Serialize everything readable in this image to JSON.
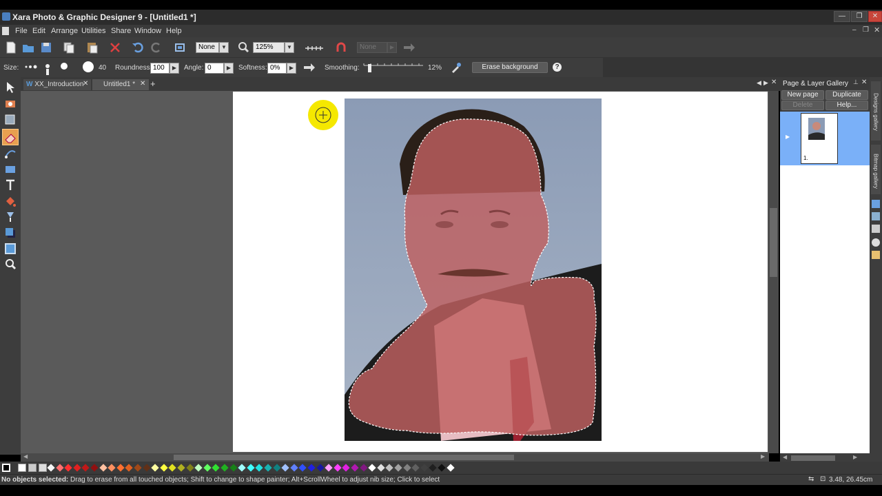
{
  "window": {
    "title": "Xara Photo & Graphic Designer 9 - [Untitled1 *]"
  },
  "menu": [
    "File",
    "Edit",
    "Arrange",
    "Utilities",
    "Share",
    "Window",
    "Help"
  ],
  "toolbar": {
    "quality_select": "None",
    "zoom_select": "125%",
    "disabled_select": "None"
  },
  "infobar": {
    "size_label": "Size:",
    "size_value": "40",
    "roundness_label": "Roundness:",
    "roundness_value": "100",
    "angle_label": "Angle:",
    "angle_value": "0",
    "softness_label": "Softness:",
    "softness_value": "0%",
    "smoothing_label": "Smoothing:",
    "smoothing_value": "12%",
    "erase_background_label": "Erase background",
    "help_icon": "?"
  },
  "tabs": [
    {
      "label": "XX_Introduction",
      "icon": "W"
    },
    {
      "label": "Untitled1 *"
    }
  ],
  "gallery": {
    "title": "Page & Layer Gallery",
    "new_page": "New page",
    "duplicate": "Duplicate",
    "delete": "Delete",
    "help": "Help...",
    "page_number": "1.",
    "side_tabs": [
      "Designs gallery",
      "Bitmap gallery"
    ]
  },
  "status": {
    "message_bold": "No objects selected:",
    "message": " Drag to erase from all touched objects; Shift to change to shape painter; Alt+ScrollWheel to adjust nib size; Click to select",
    "coords": "3.48, 26.45cm"
  },
  "palette": [
    "#f5f5f5",
    "#ff7070",
    "#ff3030",
    "#e02020",
    "#c01818",
    "#901010",
    "#ffc0a0",
    "#ff9060",
    "#ff7030",
    "#e06020",
    "#a04818",
    "#603018",
    "#ffffa0",
    "#ffff40",
    "#e0e020",
    "#b0b020",
    "#808018",
    "#c0ffc0",
    "#60ff60",
    "#30e030",
    "#20b020",
    "#188018",
    "#a0ffff",
    "#40ffff",
    "#20e0e0",
    "#18b0b0",
    "#108080",
    "#a0c0ff",
    "#6080ff",
    "#3050ff",
    "#2020e0",
    "#1818a0",
    "#ffa0ff",
    "#ff40ff",
    "#e020e0",
    "#b018b0",
    "#801880",
    "#ffffff",
    "#e0e0e0",
    "#c0c0c0",
    "#a0a0a0",
    "#808080",
    "#606060",
    "#404040",
    "#202020",
    "#101010",
    "#ffffff"
  ]
}
